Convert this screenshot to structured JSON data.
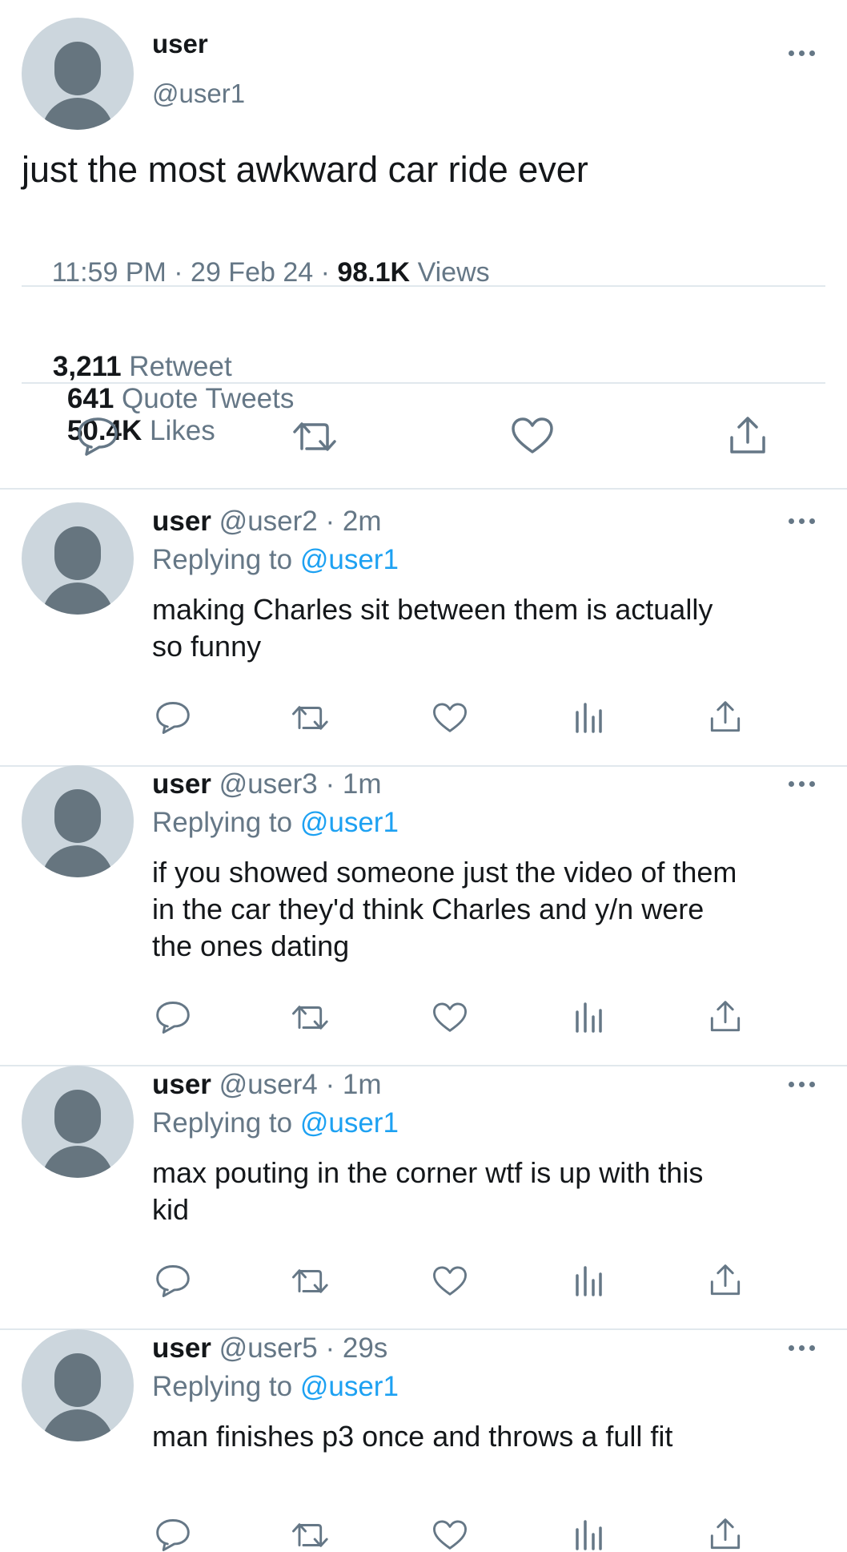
{
  "main_tweet": {
    "display_name": "user",
    "handle": "@user1",
    "text": "just the most awkward car ride ever",
    "time": "11:59 PM",
    "sep1": " · ",
    "date": "29 Feb 24",
    "sep2": " · ",
    "views_count": "98.1K",
    "views_label": "Views",
    "stats": {
      "retweet_count": "3,211",
      "retweet_label": "Retweet",
      "quote_count": "641",
      "quote_label": "Quote Tweets",
      "likes_count": "50.4K",
      "likes_label": "Likes"
    }
  },
  "replying_label": "Replying to",
  "replies": [
    {
      "display_name": "user",
      "meta": "@user2 · 2m",
      "reply_to": "@user1",
      "line1": "making Charles sit between them is actually",
      "line2": "so funny",
      "line3": ""
    },
    {
      "display_name": "user",
      "meta": "@user3 · 1m",
      "reply_to": "@user1",
      "line1": "if you showed someone just the video of them",
      "line2": "in the car they'd think Charles and y/n were",
      "line3": "the ones dating"
    },
    {
      "display_name": "user",
      "meta": "@user4 · 1m",
      "reply_to": "@user1",
      "line1": "max pouting in the corner wtf is up with this",
      "line2": "kid",
      "line3": ""
    },
    {
      "display_name": "user",
      "meta": "@user5 · 29s",
      "reply_to": "@user1",
      "line1": "man finishes p3 once and throws a full fit",
      "line2": "",
      "line3": ""
    }
  ],
  "icons": [
    "more-icon",
    "reply-icon",
    "retweet-icon",
    "like-icon",
    "analytics-icon",
    "share-icon"
  ],
  "colors": {
    "text": "#14171a",
    "secondary": "#657786",
    "link": "#1da1f2",
    "divider": "#e1e8ed",
    "avatar_bg": "#ccd6dd"
  }
}
